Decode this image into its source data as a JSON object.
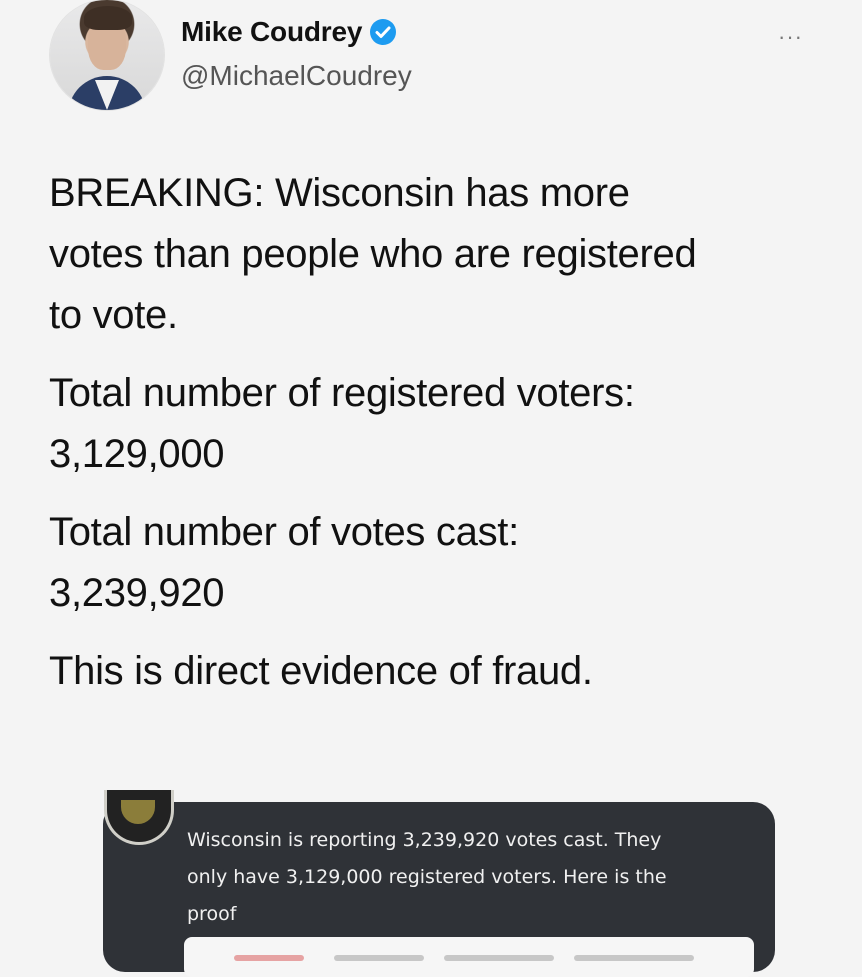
{
  "tweet": {
    "author": {
      "name": "Mike Coudrey",
      "handle": "@MichaelCoudrey",
      "verified": true,
      "avatar_icon": "profile-photo"
    },
    "more_label": "···",
    "paragraphs": [
      "BREAKING: Wisconsin has more votes than people who are registered to vote.",
      "Total number of registered voters: 3,129,000",
      "Total number of votes cast: 3,239,920",
      "This is direct evidence of fraud."
    ],
    "lines": [
      "BREAKING: Wisconsin has more",
      "votes than people who are registered",
      "to vote.",
      "Total number of registered voters:",
      "3,129,000",
      "Total number of votes cast:",
      "3,239,920",
      "This is direct evidence of fraud."
    ]
  },
  "embedded_post": {
    "lines": [
      "Wisconsin is reporting 3,239,920 votes cast. They",
      "only have 3,129,000 registered voters. Here is the",
      "proof"
    ]
  },
  "colors": {
    "verified_badge": "#1d9bf0",
    "card_background": "#2f3237",
    "page_background": "#f4f4f4"
  }
}
